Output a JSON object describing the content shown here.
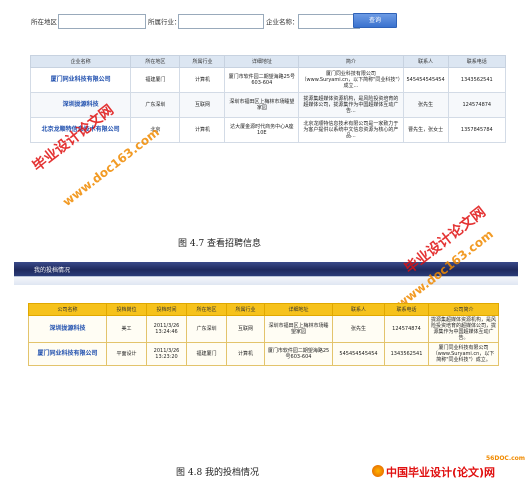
{
  "search": {
    "region_label": "所在地区：",
    "industry_label": "所属行业：",
    "company_label": "企业名称：",
    "button_label": "查询",
    "region_value": "",
    "industry_value": "",
    "company_value": ""
  },
  "table1": {
    "headers": [
      "企业名称",
      "所在地区",
      "所属行业",
      "详细地址",
      "简介",
      "联系人",
      "联系电话"
    ],
    "rows": [
      {
        "name": "厦门同业科技有限公司",
        "region": "福建厦门",
        "industry": "计算机",
        "address": "厦门市软件园二期望海路25号603-604",
        "intro": "厦门同业科技有限公司（www.Suryami.cn，以下简称\"同业科技\"）成立...",
        "contact": "545454545454",
        "phone": "1343562541"
      },
      {
        "name": "深圳拢源科技",
        "region": "广东深圳",
        "industry": "互联网",
        "address": "深圳市福田区上梅林市场睡望家园",
        "intro": "拢源集超媒体资源机构，是风险投资培育的超媒体公司，拢源集作为中国超媒体互动广告...",
        "contact": "张先生",
        "phone": "124574874"
      },
      {
        "name": "北京龙顺特信息技术有限公司",
        "region": "北京",
        "industry": "计算机",
        "address": "达大厦金源时代商务中心A座10E",
        "intro": "北京龙顺特信息技术有限公司是一家致力于为客户提供以系统中文信息资源为核心的产品...",
        "contact": "曹先生，张女士",
        "phone": "1357845784"
      }
    ]
  },
  "captions": {
    "fig47": "图 4.7 查看招聘信息",
    "fig48": "图 4.8 我的投档情况"
  },
  "section2": {
    "title": "我的投档情况"
  },
  "table2": {
    "headers": [
      "公司名称",
      "投档岗位",
      "投档时间",
      "所在地区",
      "所属行业",
      "详细地址",
      "联系人",
      "联系电话",
      "公司简介"
    ],
    "rows": [
      {
        "name": "深圳拢源科技",
        "position": "美工",
        "time": "2011/3/26 13:24:46",
        "region": "广东深圳",
        "industry": "互联网",
        "address": "深圳市福田区上梅林市场睡望家园",
        "contact": "张先生",
        "phone": "124574874",
        "intro": "拢源集超媒体资源机构，是风险投资培育的超媒体公司，拢源集作为中国超媒体互动广告。"
      },
      {
        "name": "厦门同业科技有限公司",
        "position": "平面设计",
        "time": "2011/3/26 13:23:20",
        "region": "福建厦门",
        "industry": "计算机",
        "address": "厦门市软件园二期望海路25号603-604",
        "contact": "545454545454",
        "phone": "1343562541",
        "intro": "厦门同业科技有限公司（www.Suryami.cn，以下简称\"同业科技\"）成立。"
      }
    ]
  },
  "watermarks": {
    "wm1": "毕业设计论文网",
    "wm2": "www.doc163.com",
    "wm3": "毕业设计论文网",
    "wm4": "www.doc163.com",
    "logo_domain": "56DOC.com",
    "logo_text": "中国毕业设计(论文)网",
    "colors": {
      "red": "#e01010",
      "orange": "#f08a00"
    }
  }
}
